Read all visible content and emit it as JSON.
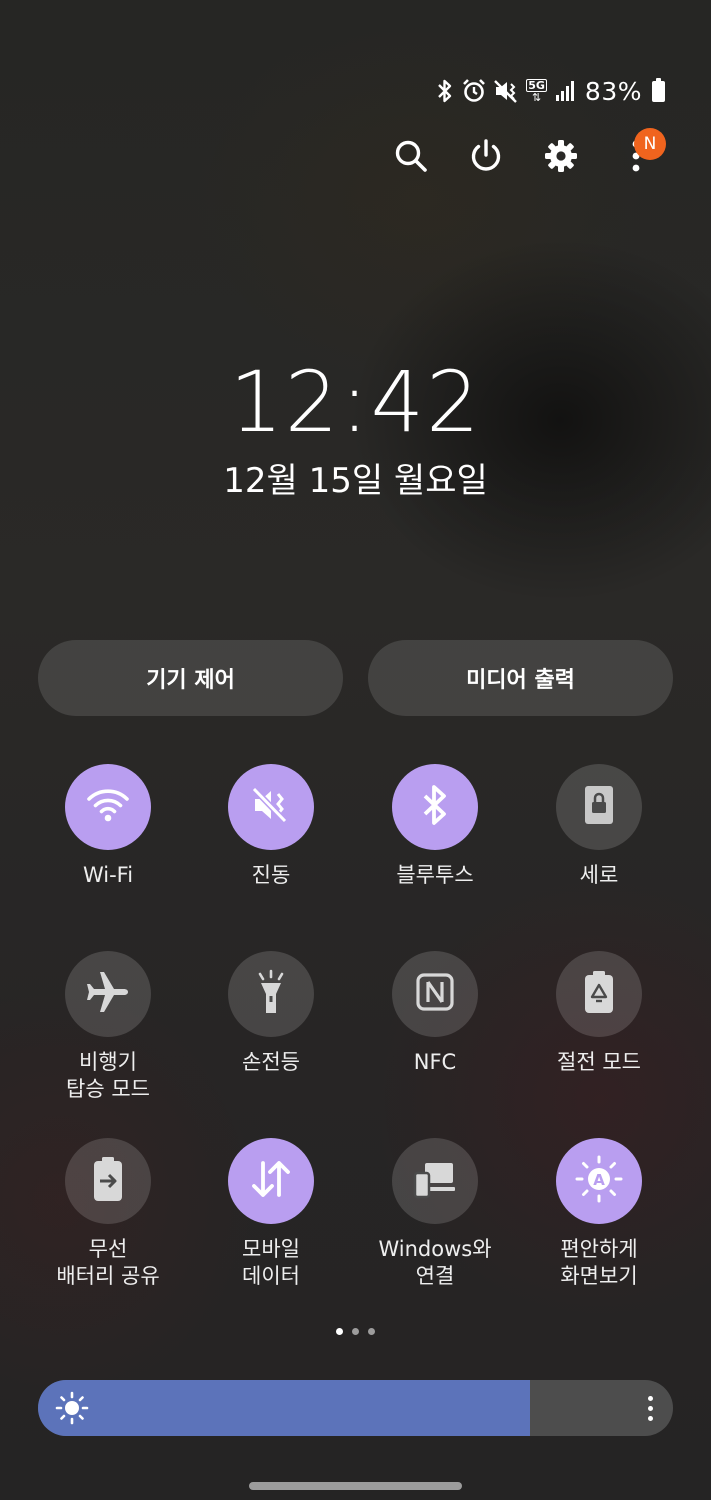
{
  "status_bar": {
    "icons": [
      "bluetooth-icon",
      "alarm-icon",
      "vibrate-icon",
      "5g-icon",
      "signal-icon"
    ],
    "network_label": "5G",
    "battery_text": "83%",
    "battery_level": 0.83
  },
  "top_actions": {
    "icons": [
      "search-icon",
      "power-icon",
      "gear-icon",
      "more-vertical-icon"
    ],
    "notification_badge": "N",
    "badge_color": "#f0641e"
  },
  "clock": {
    "time": "12:42",
    "date": "12월 15일 월요일"
  },
  "pills": {
    "device_control": "기기 제어",
    "media_output": "미디어 출력"
  },
  "tiles": [
    {
      "label": "Wi-Fi",
      "icon": "wifi-icon",
      "on": true
    },
    {
      "label": "진동",
      "icon": "vibrate-icon",
      "on": true
    },
    {
      "label": "블루투스",
      "icon": "bluetooth-icon",
      "on": true
    },
    {
      "label": "세로",
      "icon": "portrait-lock-icon",
      "on": false
    },
    {
      "label": "비행기\n탑승 모드",
      "icon": "airplane-icon",
      "on": false
    },
    {
      "label": "손전등",
      "icon": "flashlight-icon",
      "on": false
    },
    {
      "label": "NFC",
      "icon": "nfc-icon",
      "on": false
    },
    {
      "label": "절전 모드",
      "icon": "power-saving-icon",
      "on": false
    },
    {
      "label": "무선\n배터리 공유",
      "icon": "wireless-battery-share-icon",
      "on": false
    },
    {
      "label": "모바일\n데이터",
      "icon": "mobile-data-icon",
      "on": true
    },
    {
      "label": "Windows와\n연결",
      "icon": "link-to-windows-icon",
      "on": false
    },
    {
      "label": "편안하게\n화면보기",
      "icon": "eye-comfort-icon",
      "on": true
    }
  ],
  "page_indicator": {
    "count": 3,
    "active": 1
  },
  "brightness": {
    "level": 0.775,
    "icon": "sun-icon"
  },
  "colors": {
    "tile_on": "#b99ef0",
    "brightness_fill": "#5c73ba"
  }
}
